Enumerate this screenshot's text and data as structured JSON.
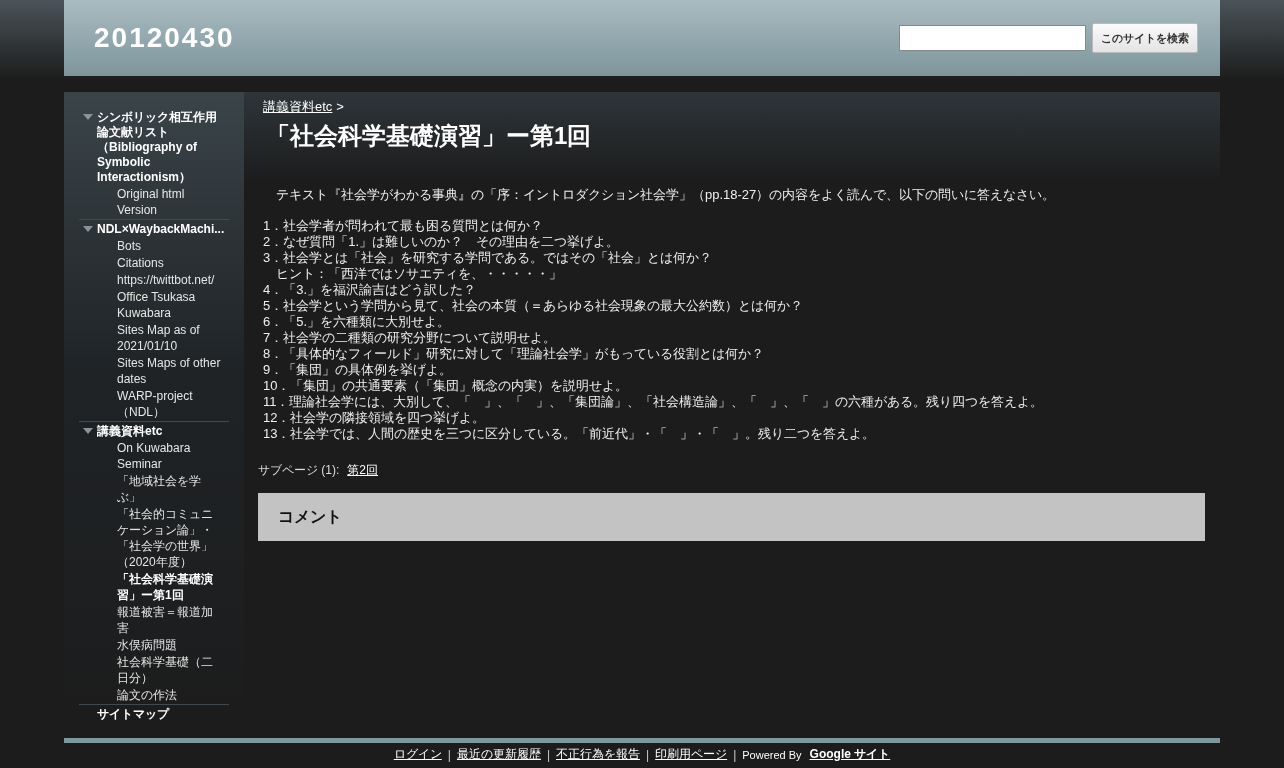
{
  "header": {
    "site_title": "20120430",
    "search": {
      "button": "このサイトを検索"
    }
  },
  "sidebar": {
    "items": [
      {
        "label": "シンボリック相互作用論文献リスト（Bibliography of Symbolic Interactionism）",
        "expanded": true,
        "selected": false,
        "children": [
          {
            "label": "Original html Version",
            "selected": false
          }
        ]
      },
      {
        "label": "NDL×WaybackMachi...",
        "expanded": true,
        "selected": false,
        "children": [
          {
            "label": "Bots",
            "selected": false
          },
          {
            "label": "Citations",
            "selected": false
          },
          {
            "label": "https://twittbot.net/",
            "selected": false
          },
          {
            "label": "Office Tsukasa Kuwabara",
            "selected": false
          },
          {
            "label": "Sites Map as of 2021/01/10",
            "selected": false
          },
          {
            "label": "Sites Maps of other dates",
            "selected": false
          },
          {
            "label": "WARP-project（NDL）",
            "selected": false
          }
        ]
      },
      {
        "label": "講義資料etc",
        "expanded": true,
        "selected": false,
        "children": [
          {
            "label": "On Kuwabara Seminar",
            "selected": false
          },
          {
            "label": "「地域社会を学ぶ」",
            "selected": false
          },
          {
            "label": "「社会的コミュニケーション論」・「社会学の世界」（2020年度）",
            "selected": false
          },
          {
            "label": "「社会科学基礎演習」ー第1回",
            "selected": true
          },
          {
            "label": "報道被害＝報道加害",
            "selected": false
          },
          {
            "label": "水俣病問題",
            "selected": false
          },
          {
            "label": "社会科学基礎（二日分）",
            "selected": false
          },
          {
            "label": "論文の作法",
            "selected": false
          }
        ]
      },
      {
        "label": "サイトマップ",
        "selected": false
      }
    ]
  },
  "content": {
    "breadcrumb": {
      "link": "講義資料etc",
      "separator": ">"
    },
    "title": "「社会科学基礎演習」ー第1回",
    "intro": "　テキスト『社会学がわかる事典』の「序：イントロダクション社会学」（pp.18-27）の内容をよく読んで、以下の問いに答えなさい。",
    "questions": [
      "1．社会学者が問われて最も困る質問とは何か？",
      "2．なぜ質問「1.」は難しいのか？　その理由を二つ挙げよ。",
      "3．社会学とは「社会」を研究する学問である。ではその「社会」とは何か？",
      "　ヒント：「西洋ではソサエティを、・・・・・」",
      "4．「3.」を福沢諭吉はどう訳した？",
      "5．社会学という学問から見て、社会の本質（＝あらゆる社会現象の最大公約数）とは何か？",
      "6．「5.」を六種類に大別せよ。",
      "7．社会学の二種類の研究分野について説明せよ。",
      "8．「具体的なフィールド」研究に対して「理論社会学」がもっている役割とは何か？",
      "9．「集団」の具体例を挙げよ。",
      "10．「集団」の共通要素（「集団」概念の内実）を説明せよ。",
      "11．理論社会学には、大別して、「　」、「　」、「集団論」、「社会構造論」、「　」、「　」の六種がある。残り四つを答えよ。",
      "12．社会学の隣接領域を四つ挙げよ。",
      "13．社会学では、人間の歴史を三つに区分している。「前近代」・「　」・「　」。残り二つを答えよ。"
    ],
    "subpages": {
      "label": "サブページ (1):",
      "links": [
        "第2回"
      ]
    },
    "comments": {
      "title": "コメント"
    }
  },
  "footer": {
    "items": [
      {
        "kind": "link",
        "text": "ログイン"
      },
      {
        "kind": "sep",
        "text": "|"
      },
      {
        "kind": "link",
        "text": "最近の更新履歴"
      },
      {
        "kind": "sep",
        "text": "|"
      },
      {
        "kind": "link",
        "text": "不正行為を報告"
      },
      {
        "kind": "sep",
        "text": "|"
      },
      {
        "kind": "link",
        "text": "印刷用ページ"
      },
      {
        "kind": "sep",
        "text": "|"
      },
      {
        "kind": "plain",
        "text": "Powered By"
      },
      {
        "kind": "brand",
        "text": "Google サイト"
      }
    ]
  }
}
